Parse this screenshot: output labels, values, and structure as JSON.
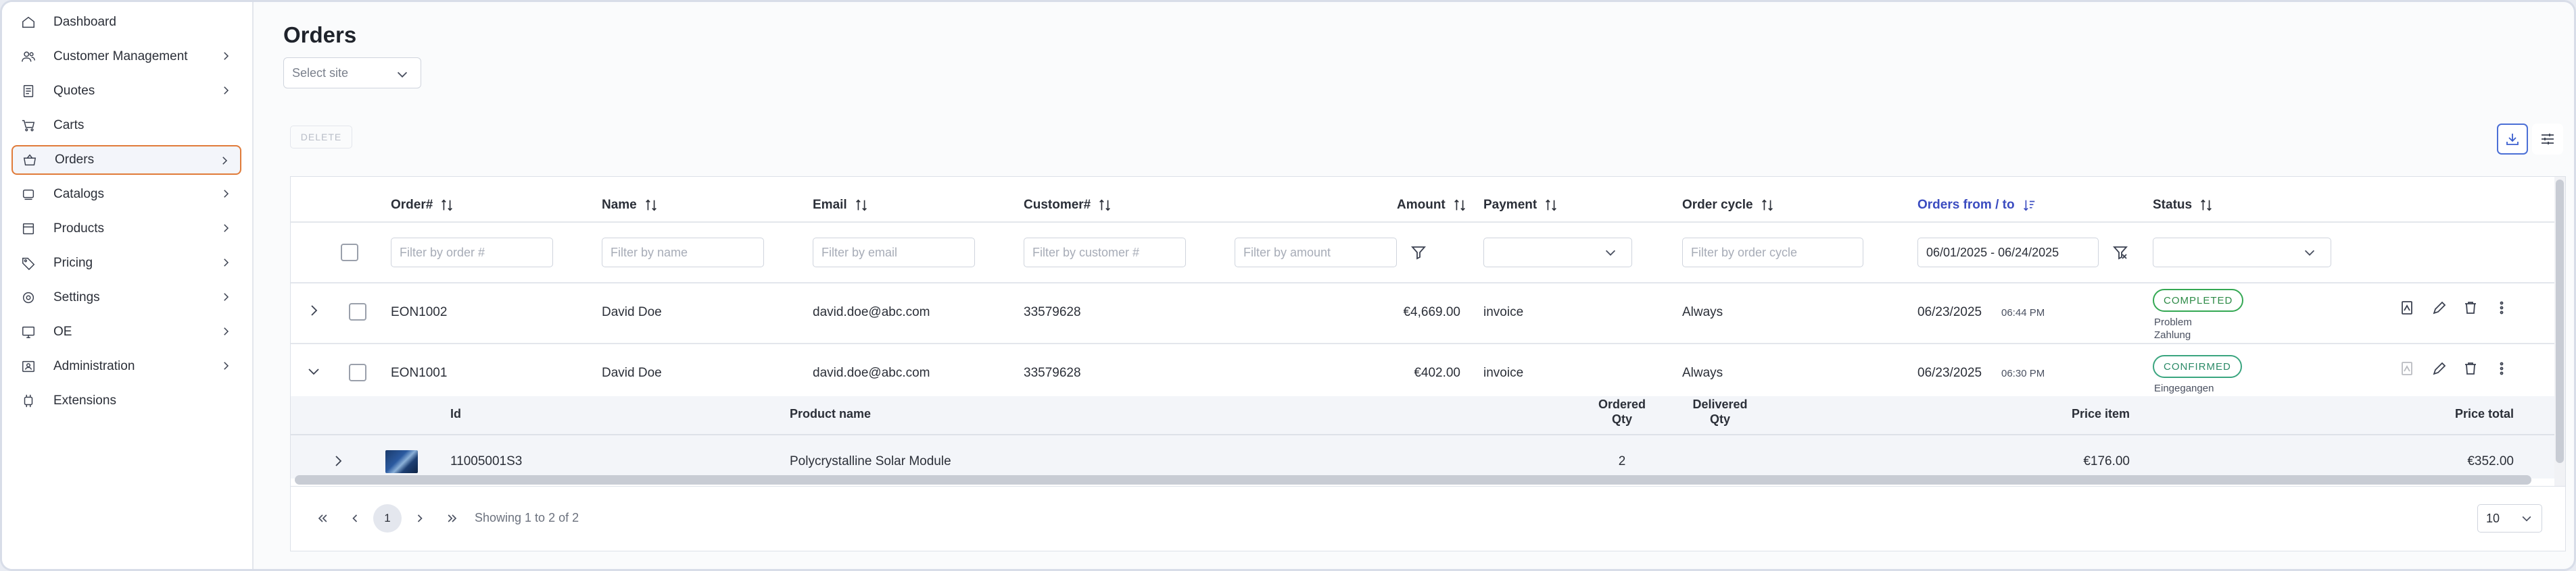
{
  "sidebar": {
    "items": [
      {
        "label": "Dashboard"
      },
      {
        "label": "Customer Management"
      },
      {
        "label": "Quotes"
      },
      {
        "label": "Carts"
      },
      {
        "label": "Orders"
      },
      {
        "label": "Catalogs"
      },
      {
        "label": "Products"
      },
      {
        "label": "Pricing"
      },
      {
        "label": "Settings"
      },
      {
        "label": "OE"
      },
      {
        "label": "Administration"
      },
      {
        "label": "Extensions"
      }
    ],
    "active_index": 4,
    "accent_color": "#e07b39"
  },
  "page": {
    "title": "Orders",
    "site_select_placeholder": "Select site",
    "delete_label": "DELETE"
  },
  "table": {
    "headers": {
      "order": "Order#",
      "name": "Name",
      "email": "Email",
      "customer": "Customer#",
      "amount": "Amount",
      "payment": "Payment",
      "order_cycle": "Order cycle",
      "orders_from_to": "Orders from / to",
      "status": "Status"
    },
    "filters": {
      "order": "Filter by order #",
      "name": "Filter by name",
      "email": "Filter by email",
      "customer": "Filter by customer #",
      "amount": "Filter by amount",
      "order_cycle": "Filter by order cycle",
      "date_range": "06/01/2025 - 06/24/2025"
    },
    "rows": [
      {
        "order": "EON1002",
        "name": "David Doe",
        "email": "david.doe@abc.com",
        "customer": "33579628",
        "amount": "€4,669.00",
        "payment": "invoice",
        "order_cycle": "Always",
        "date": "06/23/2025",
        "time": "06:44 PM",
        "status": "COMPLETED",
        "status_note_1": "Problem",
        "status_note_2": "Zahlung"
      },
      {
        "order": "EON1001",
        "name": "David Doe",
        "email": "david.doe@abc.com",
        "customer": "33579628",
        "amount": "€402.00",
        "payment": "invoice",
        "order_cycle": "Always",
        "date": "06/23/2025",
        "time": "06:30 PM",
        "status": "CONFIRMED",
        "status_note_1": "Eingegangen"
      }
    ],
    "sub_table": {
      "headers": {
        "id": "Id",
        "product_name": "Product name",
        "ordered_qty_1": "Ordered",
        "ordered_qty_2": "Qty",
        "delivered_qty_1": "Delivered",
        "delivered_qty_2": "Qty",
        "price_item": "Price item",
        "price_total": "Price total"
      },
      "rows": [
        {
          "id": "11005001S3",
          "product_name": "Polycrystalline Solar Module",
          "ordered_qty": "2",
          "delivered_qty": "",
          "price_item": "€176.00",
          "price_total": "€352.00"
        }
      ]
    }
  },
  "pagination": {
    "current_page": "1",
    "showing": "Showing 1 to 2 of 2",
    "per_page": "10"
  }
}
